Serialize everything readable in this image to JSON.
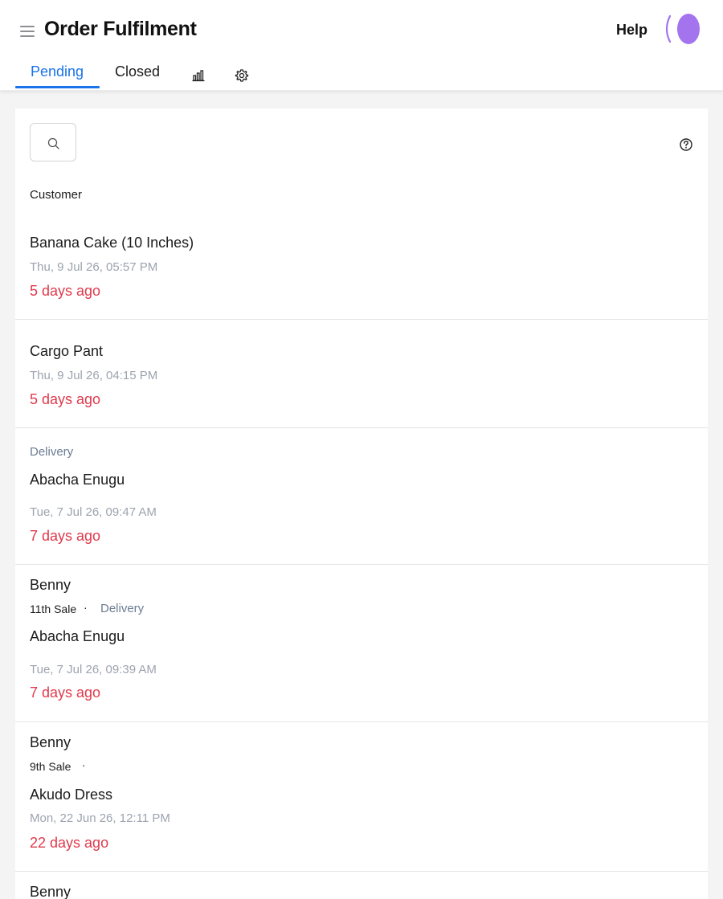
{
  "app": {
    "title": "Order Fulfilment",
    "help_label": "Help"
  },
  "tabs": [
    {
      "label": "Pending",
      "active": true
    },
    {
      "label": "Closed",
      "active": false
    },
    {
      "icon": "bar-chart-icon"
    },
    {
      "icon": "gear-icon"
    }
  ],
  "list": {
    "column_header": "Customer",
    "orders": [
      {
        "product": "Banana Cake (10 Inches)",
        "date": "Thu, 9 Jul 26, 05:57 PM",
        "age": "5 days ago"
      },
      {
        "product": "Cargo Pant",
        "date": "Thu, 9 Jul 26, 04:15 PM",
        "age": "5 days ago"
      },
      {
        "tag": "Delivery",
        "product": "Abacha Enugu",
        "date": "Tue, 7 Jul 26, 09:47 AM",
        "age": "7 days ago"
      },
      {
        "customer": "Benny",
        "sale": "11th Sale",
        "separator": "·",
        "tag": "Delivery",
        "product": "Abacha Enugu",
        "date": "Tue, 7 Jul 26, 09:39 AM",
        "age": "7 days ago"
      },
      {
        "customer": "Benny",
        "sale": "9th Sale",
        "separator": "·",
        "product": "Akudo Dress",
        "date": "Mon, 22 Jun 26, 12:11 PM",
        "age": "22 days ago"
      },
      {
        "customer": "Benny"
      }
    ]
  },
  "colors": {
    "accent": "#1a73e8",
    "overdue": "#e0394b",
    "avatar": "#a374ee"
  }
}
